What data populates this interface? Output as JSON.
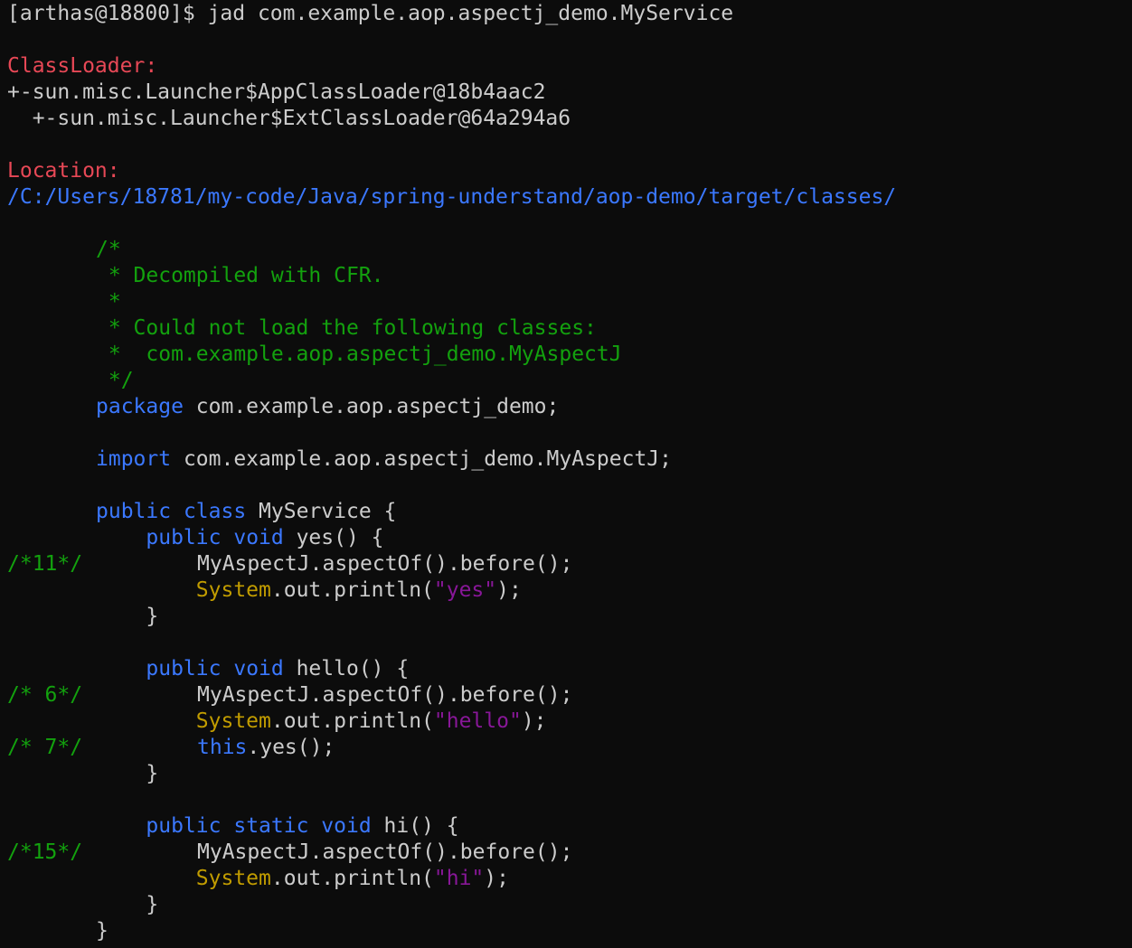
{
  "terminal": {
    "prompt": "[arthas@18800]$ ",
    "command": "jad com.example.aop.aspectj_demo.MyService",
    "classloader_label": "ClassLoader:",
    "classloader_1": "+-sun.misc.Launcher$AppClassLoader@18b4aac2",
    "classloader_2": "  +-sun.misc.Launcher$ExtClassLoader@64a294a6",
    "location_label": "Location:",
    "location_path": "/C:/Users/18781/my-code/Java/spring-understand/aop-demo/target/classes/"
  },
  "code": {
    "comment_1": "/*",
    "comment_2": " * Decompiled with CFR.",
    "comment_3": " *",
    "comment_4": " * Could not load the following classes:",
    "comment_5": " *  com.example.aop.aspectj_demo.MyAspectJ",
    "comment_6": " */",
    "kw_package": "package",
    "package_name": " com.example.aop.aspectj_demo;",
    "kw_import": "import",
    "import_name": " com.example.aop.aspectj_demo.MyAspectJ;",
    "kw_public": "public",
    "kw_class": "class",
    "kw_void": "void",
    "kw_static": "static",
    "kw_this": "this",
    "class_decl": " MyService {",
    "method_yes": " yes() {",
    "method_hello": " hello() {",
    "method_hi": " hi() {",
    "aspect_call": "MyAspectJ.aspectOf().before();",
    "system": "System",
    "println_open": ".out.println(",
    "println_close": ");",
    "str_yes": "\"yes\"",
    "str_hello": "\"hello\"",
    "str_hi": "\"hi\"",
    "this_call": ".yes();",
    "close_brace": "}",
    "ln_11": "/*11*/",
    "ln_6": "/* 6*/",
    "ln_7": "/* 7*/",
    "ln_15": "/*15*/"
  }
}
